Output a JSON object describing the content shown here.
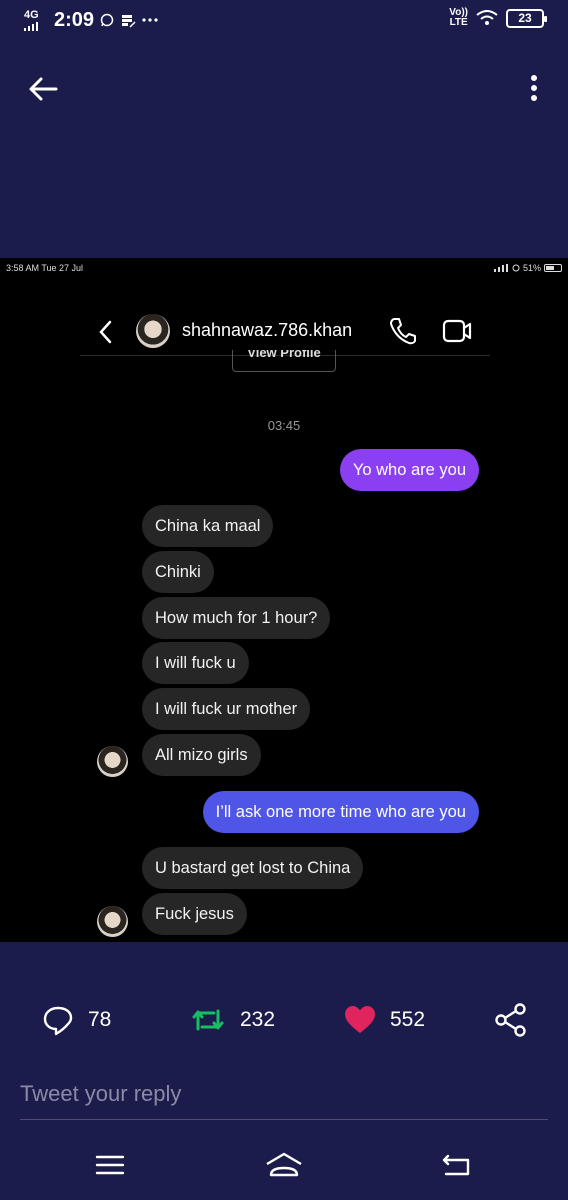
{
  "status_bar": {
    "network": "4G",
    "time": "2:09",
    "icons": [
      "whatsapp-icon",
      "data-saver-icon",
      "more-notifications-icon"
    ],
    "volte_top": "Vo))",
    "volte_bottom": "LTE",
    "battery": "23"
  },
  "top_bar": {
    "back_icon": "arrow-left-icon",
    "menu_icon": "more-vertical-icon"
  },
  "screenshot": {
    "status_left": "3:58 AM  Tue 27 Jul",
    "status_right": "51%",
    "chat_header": {
      "username": "shahnawaz.786.khan",
      "back_icon": "chevron-left-icon",
      "call_icon": "phone-icon",
      "video_icon": "video-camera-icon"
    },
    "view_profile": "View Profile",
    "timestamp": "03:45",
    "messages": [
      {
        "from": "me",
        "text": "Yo who are you"
      },
      {
        "from": "them",
        "text": "China ka maal"
      },
      {
        "from": "them",
        "text": "Chinki"
      },
      {
        "from": "them",
        "text": "How much for 1 hour?"
      },
      {
        "from": "them",
        "text": "I will fuck u"
      },
      {
        "from": "them",
        "text": "I will fuck ur mother"
      },
      {
        "from": "them",
        "text": "All mizo girls"
      },
      {
        "from": "me",
        "text": "I’ll ask one more time who are you"
      },
      {
        "from": "them",
        "text": "U bastard get lost to China"
      },
      {
        "from": "them",
        "text": "Fuck jesus"
      }
    ]
  },
  "actions": {
    "replies": "78",
    "retweets": "232",
    "likes": "552",
    "colors": {
      "retweet": "#17bf63",
      "like": "#e0245e"
    }
  },
  "reply_box": {
    "placeholder": "Tweet your reply"
  },
  "nav_bar": {
    "icons": [
      "menu-icon",
      "home-icon",
      "back-icon"
    ]
  }
}
